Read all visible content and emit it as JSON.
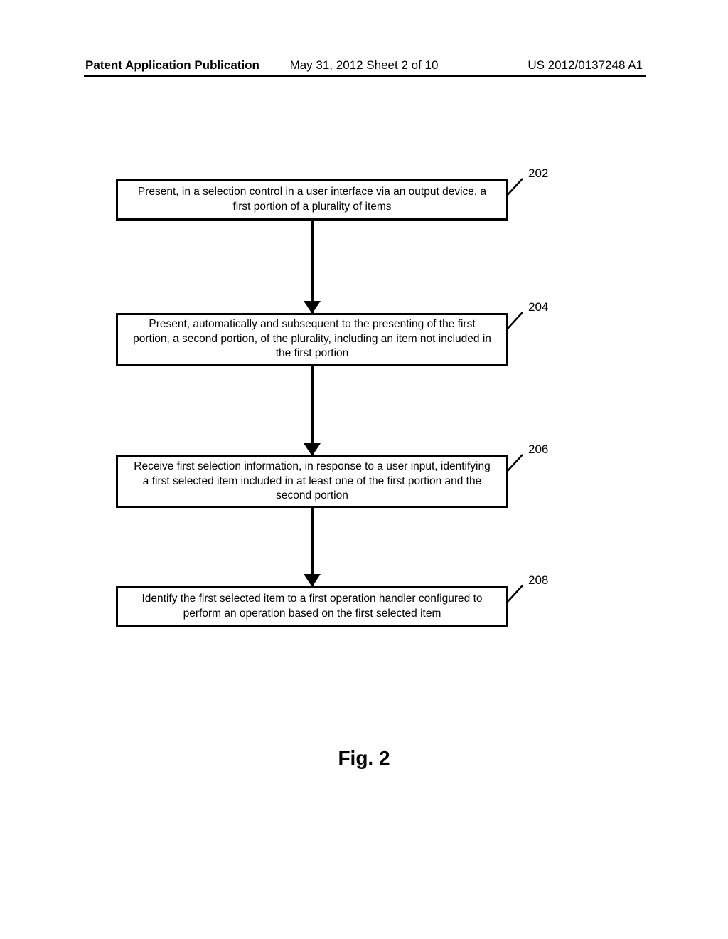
{
  "header": {
    "left": "Patent Application Publication",
    "center": "May 31, 2012  Sheet 2 of 10",
    "right": "US 2012/0137248 A1"
  },
  "flowchart": {
    "steps": [
      {
        "ref": "202",
        "text": "Present, in a selection control in a user interface via an output device, a first portion of a plurality of items"
      },
      {
        "ref": "204",
        "text": "Present, automatically and subsequent to the presenting of the first portion, a second portion, of the plurality, including an item not included in the first portion"
      },
      {
        "ref": "206",
        "text": "Receive first selection information, in response to a user input, identifying a first selected item included in at least one of the first portion and the second portion"
      },
      {
        "ref": "208",
        "text": "Identify the first selected item to a first operation handler configured to perform an operation based on the first selected item"
      }
    ]
  },
  "caption": "Fig. 2"
}
